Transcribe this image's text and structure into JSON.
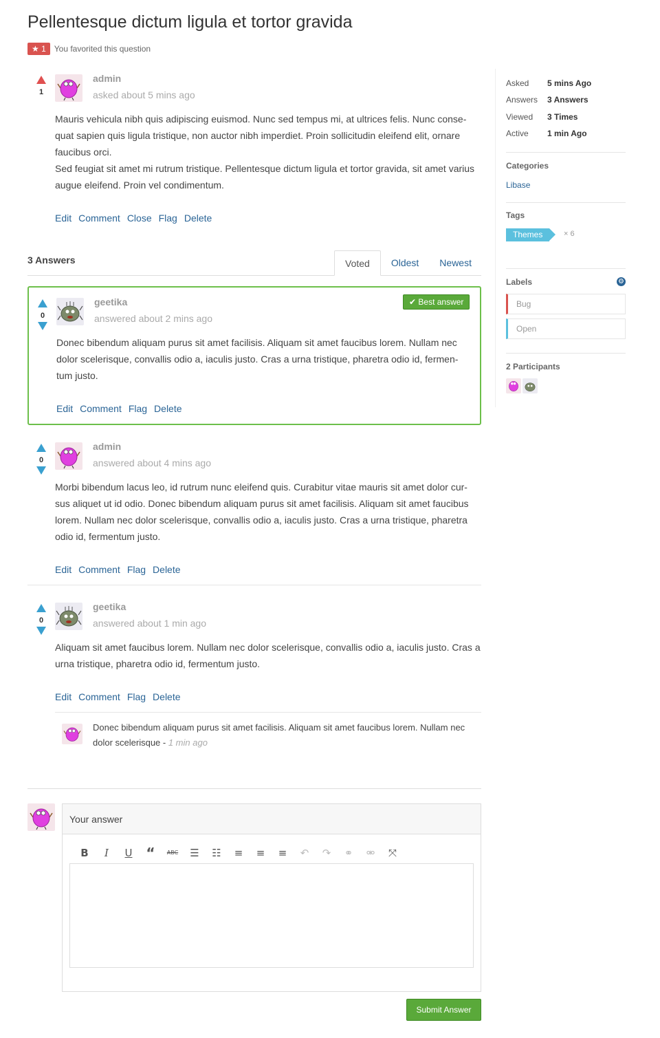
{
  "question": {
    "title": "Pellentesque dictum ligula et tortor gravida",
    "favorite_count": "★ 1",
    "favorite_text": "You favorited this question",
    "votes": "1",
    "author": "admin",
    "asked": "asked about 5 mins ago",
    "body_1": "Mauris vehicula nibh quis adipiscing euismod. Nunc sed tempus mi, at ultrices felis. Nunc conse- quat sapien quis ligula tristique, non auctor nibh imperdiet. Proin sollicitudin eleifend elit, ornare faucibus orci.",
    "body_2": "Sed feugiat sit amet mi rutrum tristique. Pellentesque dictum ligula et tortor gravida, sit amet varius augue eleifend. Proin vel condimentum.",
    "actions": [
      "Edit",
      "Comment",
      "Close",
      "Flag",
      "Delete"
    ]
  },
  "answers_header": {
    "count": "3 Answers",
    "tabs": [
      "Voted",
      "Oldest",
      "Newest"
    ]
  },
  "answers": [
    {
      "votes": "0",
      "author": "geetika",
      "meta": "answered about 2 mins ago",
      "best": "✔ Best answer",
      "body": "Donec bibendum aliquam purus sit amet facilisis. Aliquam sit amet faucibus lorem. Nullam nec dolor scelerisque, convallis odio a, iaculis justo. Cras a urna tristique, pharetra odio id, fermen- tum justo.",
      "actions": [
        "Edit",
        "Comment",
        "Flag",
        "Delete"
      ]
    },
    {
      "votes": "0",
      "author": "admin",
      "meta": "answered about 4 mins ago",
      "body": "Morbi bibendum lacus leo, id rutrum nunc eleifend quis. Curabitur vitae mauris sit amet dolor cur- sus aliquet ut id odio. Donec bibendum aliquam purus sit amet facilisis. Aliquam sit amet faucibus lorem. Nullam nec dolor scelerisque, convallis odio a, iaculis justo. Cras a urna tristique, pharetra odio id, fermentum justo.",
      "actions": [
        "Edit",
        "Comment",
        "Flag",
        "Delete"
      ]
    },
    {
      "votes": "0",
      "author": "geetika",
      "meta": "answered about 1 min ago",
      "body": "Aliquam sit amet faucibus lorem. Nullam nec dolor scelerisque, convallis odio a, iaculis justo. Cras a urna tristique, pharetra odio id, fermentum justo.",
      "actions": [
        "Edit",
        "Comment",
        "Flag",
        "Delete"
      ],
      "comment": {
        "text": "Donec bibendum aliquam purus sit amet facilisis. Aliquam sit amet faucibus lorem. Nullam nec dolor scelerisque - ",
        "time": "1 min ago"
      }
    }
  ],
  "sidebar": {
    "stats": [
      {
        "key": "Asked",
        "value": "5 mins Ago"
      },
      {
        "key": "Answers",
        "value": "3 Answers"
      },
      {
        "key": "Viewed",
        "value": "3 Times"
      },
      {
        "key": "Active",
        "value": "1 min Ago"
      }
    ],
    "categories_title": "Categories",
    "category": "Libase",
    "tags_title": "Tags",
    "tag": "Themes",
    "tag_count": "× 6",
    "labels_title": "Labels",
    "labels": [
      "Bug",
      "Open"
    ],
    "label_colors": [
      "#d9534f",
      "#5bc0de"
    ],
    "participants_title": "2 Participants"
  },
  "editor": {
    "placeholder": "Your answer",
    "toolbar": [
      "bold-icon",
      "italic-icon",
      "underline-icon",
      "quote-icon",
      "strikethrough-icon",
      "bullet-list-icon",
      "numbered-list-icon",
      "align-left-icon",
      "align-center-icon",
      "align-right-icon",
      "undo-icon",
      "redo-icon",
      "link-icon",
      "unlink-icon",
      "fullscreen-icon"
    ],
    "submit": "Submit Answer"
  }
}
